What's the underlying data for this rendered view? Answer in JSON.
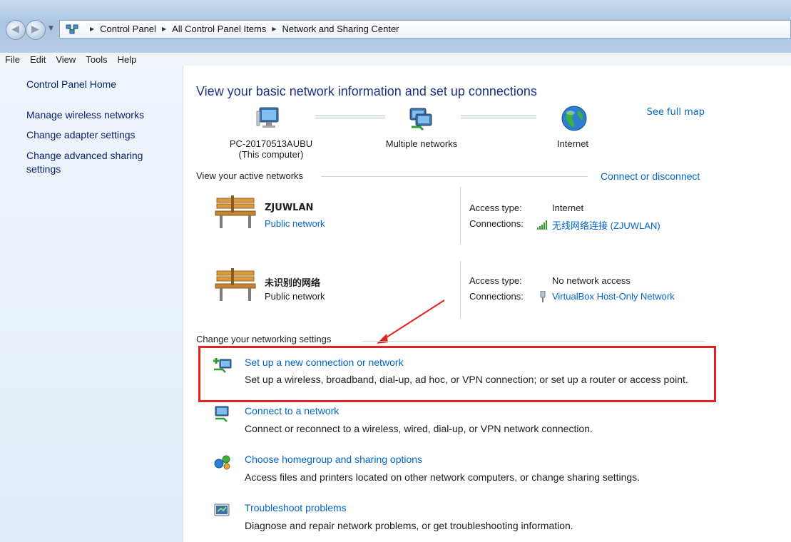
{
  "address_bar": {
    "breadcrumb": [
      "Control Panel",
      "All Control Panel Items",
      "Network and Sharing Center"
    ]
  },
  "menu": [
    "File",
    "Edit",
    "View",
    "Tools",
    "Help"
  ],
  "left_pane": {
    "home": "Control Panel Home",
    "links": [
      "Manage wireless networks",
      "Change adapter settings",
      "Change advanced sharing settings"
    ]
  },
  "main": {
    "title": "View your basic network information and set up connections",
    "see_full_map": "See full map",
    "map": {
      "computer": {
        "line1": "PC-20170513AUBU",
        "line2": "(This computer)"
      },
      "middle": "Multiple networks",
      "internet": "Internet"
    },
    "active_networks": {
      "heading": "View your active networks",
      "connect_link": "Connect or disconnect",
      "networks": [
        {
          "name": "ZJUWLAN",
          "type": "Public network",
          "access_label": "Access type:",
          "access_value": "Internet",
          "connections_label": "Connections:",
          "connection": "无线网络连接 (ZJUWLAN)"
        },
        {
          "name": "未识别的网络",
          "type": "Public network",
          "access_label": "Access type:",
          "access_value": "No network access",
          "connections_label": "Connections:",
          "connection": "VirtualBox Host-Only Network"
        }
      ]
    },
    "settings": {
      "heading": "Change your networking settings",
      "tasks": [
        {
          "link": "Set up a new connection or network",
          "desc": "Set up a wireless, broadband, dial-up, ad hoc, or VPN connection; or set up a router or access point.",
          "icon": "new-connection-icon"
        },
        {
          "link": "Connect to a network",
          "desc": "Connect or reconnect to a wireless, wired, dial-up, or VPN network connection.",
          "icon": "connect-network-icon"
        },
        {
          "link": "Choose homegroup and sharing options",
          "desc": "Access files and printers located on other network computers, or change sharing settings.",
          "icon": "homegroup-icon"
        },
        {
          "link": "Troubleshoot problems",
          "desc": "Diagnose and repair network problems, or get troubleshooting information.",
          "icon": "troubleshoot-icon"
        }
      ]
    }
  },
  "colors": {
    "link": "#0066cc",
    "title": "#1e3287",
    "highlight": "#e02424"
  }
}
